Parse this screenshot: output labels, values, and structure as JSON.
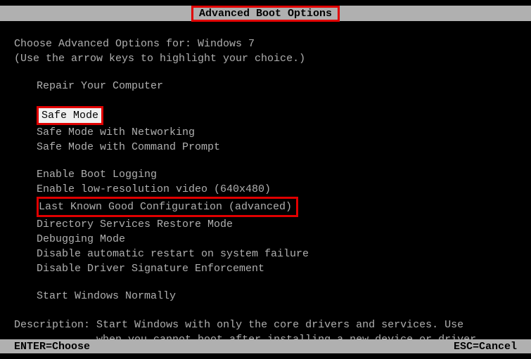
{
  "title": "Advanced Boot Options",
  "prompt_line1": "Choose Advanced Options for: Windows 7",
  "prompt_line2": "(Use the arrow keys to highlight your choice.)",
  "options": {
    "repair": "Repair Your Computer",
    "safe_mode": "Safe Mode",
    "safe_mode_net": "Safe Mode with Networking",
    "safe_mode_cmd": "Safe Mode with Command Prompt",
    "boot_logging": "Enable Boot Logging",
    "low_res": "Enable low-resolution video (640x480)",
    "last_known": "Last Known Good Configuration (advanced)",
    "ds_restore": "Directory Services Restore Mode",
    "debugging": "Debugging Mode",
    "disable_auto_restart": "Disable automatic restart on system failure",
    "disable_driver_sig": "Disable Driver Signature Enforcement",
    "start_normal": "Start Windows Normally"
  },
  "description_label": "Description:",
  "description_text_l1": "Start Windows with only the core drivers and services. Use",
  "description_text_l2": "when you cannot boot after installing a new device or driver.",
  "footer": {
    "left": "ENTER=Choose",
    "right": "ESC=Cancel"
  }
}
